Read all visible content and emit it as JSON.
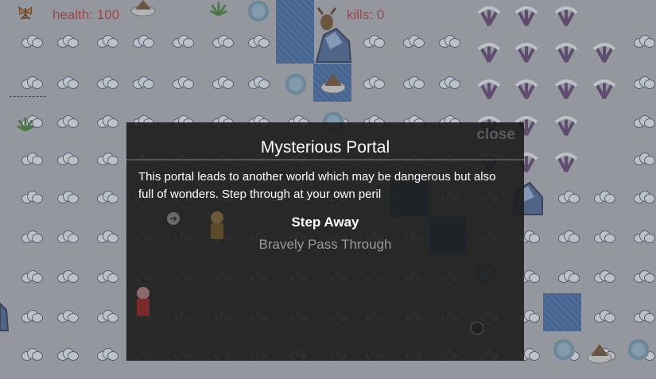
{
  "hud": {
    "health_label": "health: 100",
    "kills_label": "kills: 0"
  },
  "dialog": {
    "title": "Mysterious Portal",
    "close_label": "close",
    "message": "This portal leads to another world which may be dangerous but also full of wonders. Step through at your own peril",
    "option_primary": "Step Away",
    "option_secondary": "Bravely Pass Through"
  },
  "colors": {
    "hud_text": "#b33232",
    "dialog_bg": "#1c1c1c",
    "water": "#3e6aa8",
    "cloud": "#e9eef6"
  }
}
